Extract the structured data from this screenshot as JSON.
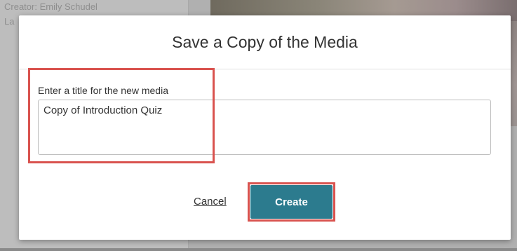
{
  "background": {
    "creator_text": "Creator: Emily Schudel",
    "last_text": "La"
  },
  "dialog": {
    "title": "Save a Copy of the Media",
    "field_label": "Enter a title for the new media",
    "input_value": "Copy of Introduction Quiz",
    "cancel_label": "Cancel",
    "create_label": "Create"
  },
  "colors": {
    "primary_button": "#2c7b8e",
    "highlight": "#d9534f"
  }
}
